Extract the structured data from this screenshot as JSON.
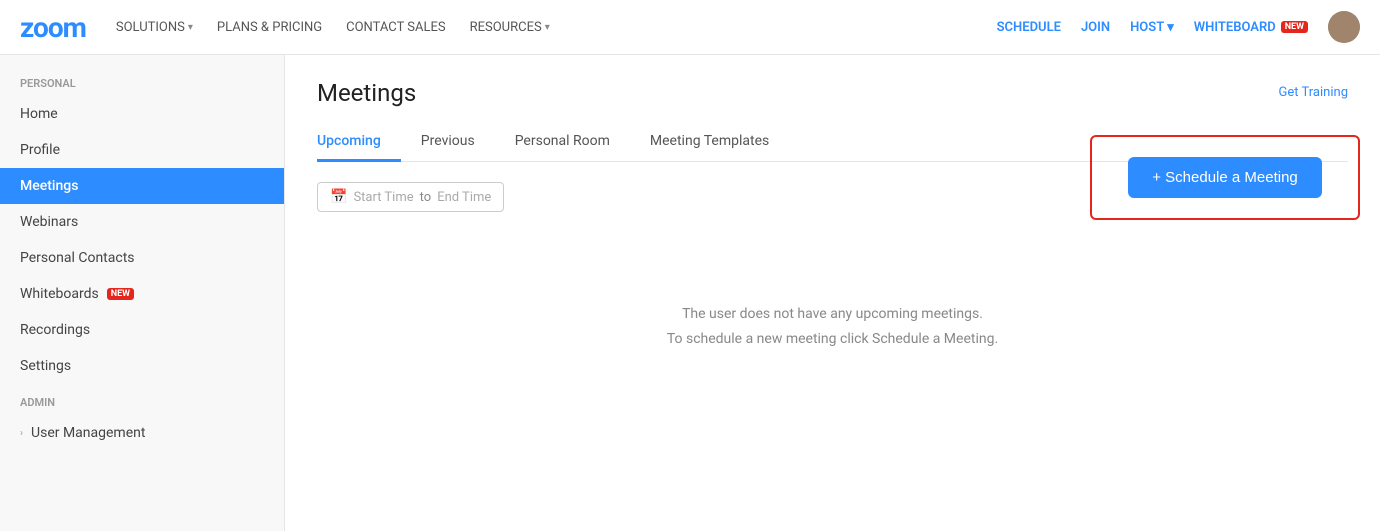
{
  "topnav": {
    "logo": "zoom",
    "nav_links": [
      {
        "label": "SOLUTIONS",
        "has_arrow": true
      },
      {
        "label": "PLANS & PRICING",
        "has_arrow": false
      },
      {
        "label": "CONTACT SALES",
        "has_arrow": false
      },
      {
        "label": "RESOURCES",
        "has_arrow": true
      }
    ],
    "right_links": [
      {
        "label": "SCHEDULE",
        "key": "schedule"
      },
      {
        "label": "JOIN",
        "key": "join"
      },
      {
        "label": "HOST",
        "key": "host",
        "has_arrow": true
      },
      {
        "label": "WHITEBOARD",
        "key": "whiteboard",
        "has_new": true
      }
    ]
  },
  "sidebar": {
    "personal_label": "PERSONAL",
    "admin_label": "ADMIN",
    "personal_items": [
      {
        "label": "Home",
        "active": false,
        "key": "home"
      },
      {
        "label": "Profile",
        "active": false,
        "key": "profile"
      },
      {
        "label": "Meetings",
        "active": true,
        "key": "meetings"
      },
      {
        "label": "Webinars",
        "active": false,
        "key": "webinars"
      },
      {
        "label": "Personal Contacts",
        "active": false,
        "key": "personal-contacts"
      },
      {
        "label": "Whiteboards",
        "active": false,
        "key": "whiteboards",
        "has_new": true
      },
      {
        "label": "Recordings",
        "active": false,
        "key": "recordings"
      },
      {
        "label": "Settings",
        "active": false,
        "key": "settings"
      }
    ],
    "admin_items": [
      {
        "label": "User Management",
        "active": false,
        "key": "user-management",
        "has_arrow": true
      }
    ]
  },
  "main": {
    "page_title": "Meetings",
    "get_training": "Get Training",
    "tabs": [
      {
        "label": "Upcoming",
        "active": true
      },
      {
        "label": "Previous",
        "active": false
      },
      {
        "label": "Personal Room",
        "active": false
      },
      {
        "label": "Meeting Templates",
        "active": false
      }
    ],
    "date_filter": {
      "start_placeholder": "Start Time",
      "to_label": "to",
      "end_placeholder": "End Time"
    },
    "schedule_button": "+ Schedule a Meeting",
    "empty_line1": "The user does not have any upcoming meetings.",
    "empty_line2": "To schedule a new meeting click Schedule a Meeting."
  }
}
